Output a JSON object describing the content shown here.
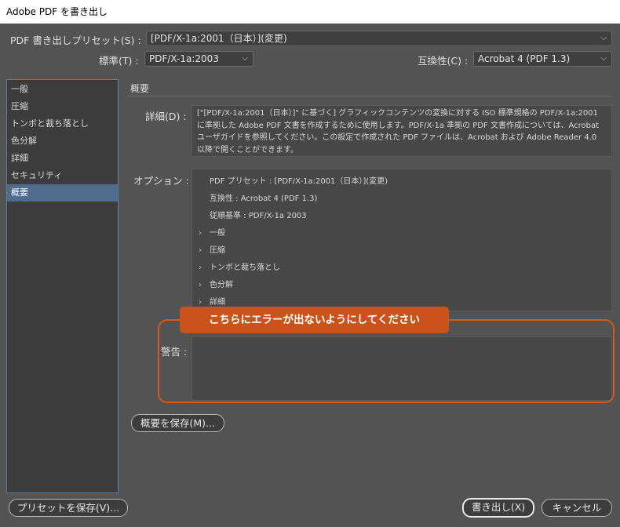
{
  "window": {
    "title": "Adobe PDF を書き出し"
  },
  "preset": {
    "label": "PDF 書き出しプリセット(S) :",
    "value": "[PDF/X-1a:2001（日本）](変更)"
  },
  "standard": {
    "label": "標準(T) :",
    "value": "PDF/X-1a:2003"
  },
  "compatibility": {
    "label": "互換性(C) :",
    "value": "Acrobat 4 (PDF 1.3)"
  },
  "sidebar": {
    "items": [
      {
        "label": "一般"
      },
      {
        "label": "圧縮"
      },
      {
        "label": "トンボと裁ち落とし"
      },
      {
        "label": "色分解"
      },
      {
        "label": "詳細"
      },
      {
        "label": "セキュリティ"
      },
      {
        "label": "概要"
      }
    ]
  },
  "summary": {
    "title": "概要",
    "detail_label": "詳細(D) :",
    "detail_text": "[\"[PDF/X-1a:2001（日本）]\" に基づく] グラフィックコンテンツの変換に対する ISO 標準規格の PDF/X-1a:2001 に準拠した Adobe PDF 文書を作成するために使用します。PDF/X-1a 準拠の PDF 文書作成については、Acrobat ユーザガイドを参照してください。この設定で作成された PDF ファイルは、Acrobat および Adobe Reader 4.0 以降で開くことができます。",
    "options_label": "オプション :",
    "options_lines": [
      "PDF プリセット : [PDF/X-1a:2001（日本）](変更)",
      "互換性 : Acrobat 4 (PDF 1.3)",
      "従順基準 : PDF/X-1a 2003"
    ],
    "option_sections": [
      "一般",
      "圧縮",
      "トンボと裁ち落とし",
      "色分解",
      "詳細"
    ],
    "warning_label": "警告 :",
    "save_summary_button": "概要を保存(M)..."
  },
  "callout": {
    "text": "こちらにエラーが出ないようにしてください"
  },
  "footer": {
    "save_preset_button": "プリセットを保存(V)...",
    "export_button": "書き出し(X)",
    "cancel_button": "キャンセル"
  },
  "icons": {
    "dropdown": "chevron-down-icon",
    "expand": "chevron-right-icon"
  },
  "colors": {
    "selection": "#506c8c",
    "annotation": "#c9531b",
    "sidebar_border": "#5b7fa7"
  }
}
